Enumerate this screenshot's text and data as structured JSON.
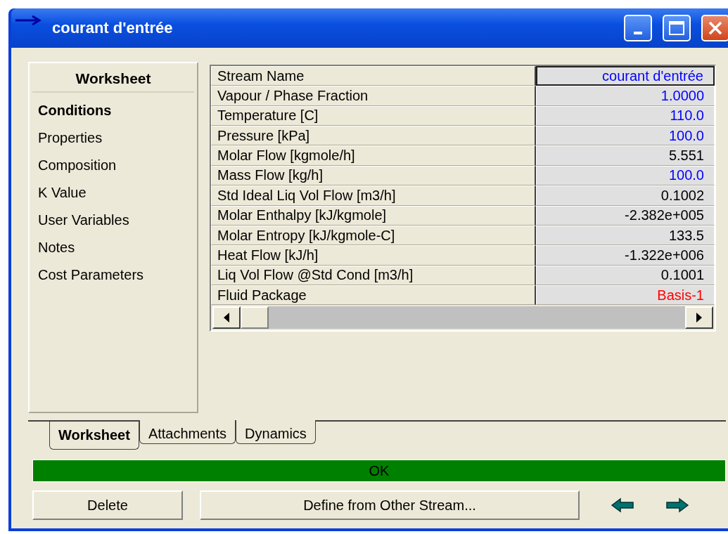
{
  "window": {
    "title": "courant d'entrée"
  },
  "sidebar": {
    "heading": "Worksheet",
    "items": [
      {
        "label": "Conditions",
        "selected": true
      },
      {
        "label": "Properties",
        "selected": false
      },
      {
        "label": "Composition",
        "selected": false
      },
      {
        "label": "K Value",
        "selected": false
      },
      {
        "label": "User Variables",
        "selected": false
      },
      {
        "label": "Notes",
        "selected": false
      },
      {
        "label": "Cost Parameters",
        "selected": false
      }
    ]
  },
  "table": {
    "rows": [
      {
        "name": "Stream Name",
        "value": "courant d'entrée",
        "color": "#0000ff",
        "selected": true
      },
      {
        "name": "Vapour / Phase Fraction",
        "value": "1.0000",
        "color": "#0000ff",
        "selected": false
      },
      {
        "name": "Temperature [C]",
        "value": "110.0",
        "color": "#0000ff",
        "selected": false
      },
      {
        "name": "Pressure [kPa]",
        "value": "100.0",
        "color": "#0000ff",
        "selected": false
      },
      {
        "name": "Molar Flow [kgmole/h]",
        "value": "5.551",
        "color": "#000000",
        "selected": false
      },
      {
        "name": "Mass Flow [kg/h]",
        "value": "100.0",
        "color": "#0000ff",
        "selected": false
      },
      {
        "name": "Std Ideal Liq Vol Flow [m3/h]",
        "value": "0.1002",
        "color": "#000000",
        "selected": false
      },
      {
        "name": "Molar Enthalpy [kJ/kgmole]",
        "value": "-2.382e+005",
        "color": "#000000",
        "selected": false
      },
      {
        "name": "Molar Entropy [kJ/kgmole-C]",
        "value": "133.5",
        "color": "#000000",
        "selected": false
      },
      {
        "name": "Heat Flow [kJ/h]",
        "value": "-1.322e+006",
        "color": "#000000",
        "selected": false
      },
      {
        "name": "Liq Vol Flow @Std Cond [m3/h]",
        "value": "0.1001",
        "color": "#000000",
        "selected": false
      },
      {
        "name": "Fluid Package",
        "value": "Basis-1",
        "color": "#ff0000",
        "selected": false
      }
    ]
  },
  "tabs": [
    {
      "label": "Worksheet",
      "selected": true
    },
    {
      "label": "Attachments",
      "selected": false
    },
    {
      "label": "Dynamics",
      "selected": false
    }
  ],
  "status_bar": {
    "text": "OK"
  },
  "buttons": [
    {
      "label": "Delete"
    },
    {
      "label": "Define from Other Stream..."
    }
  ]
}
